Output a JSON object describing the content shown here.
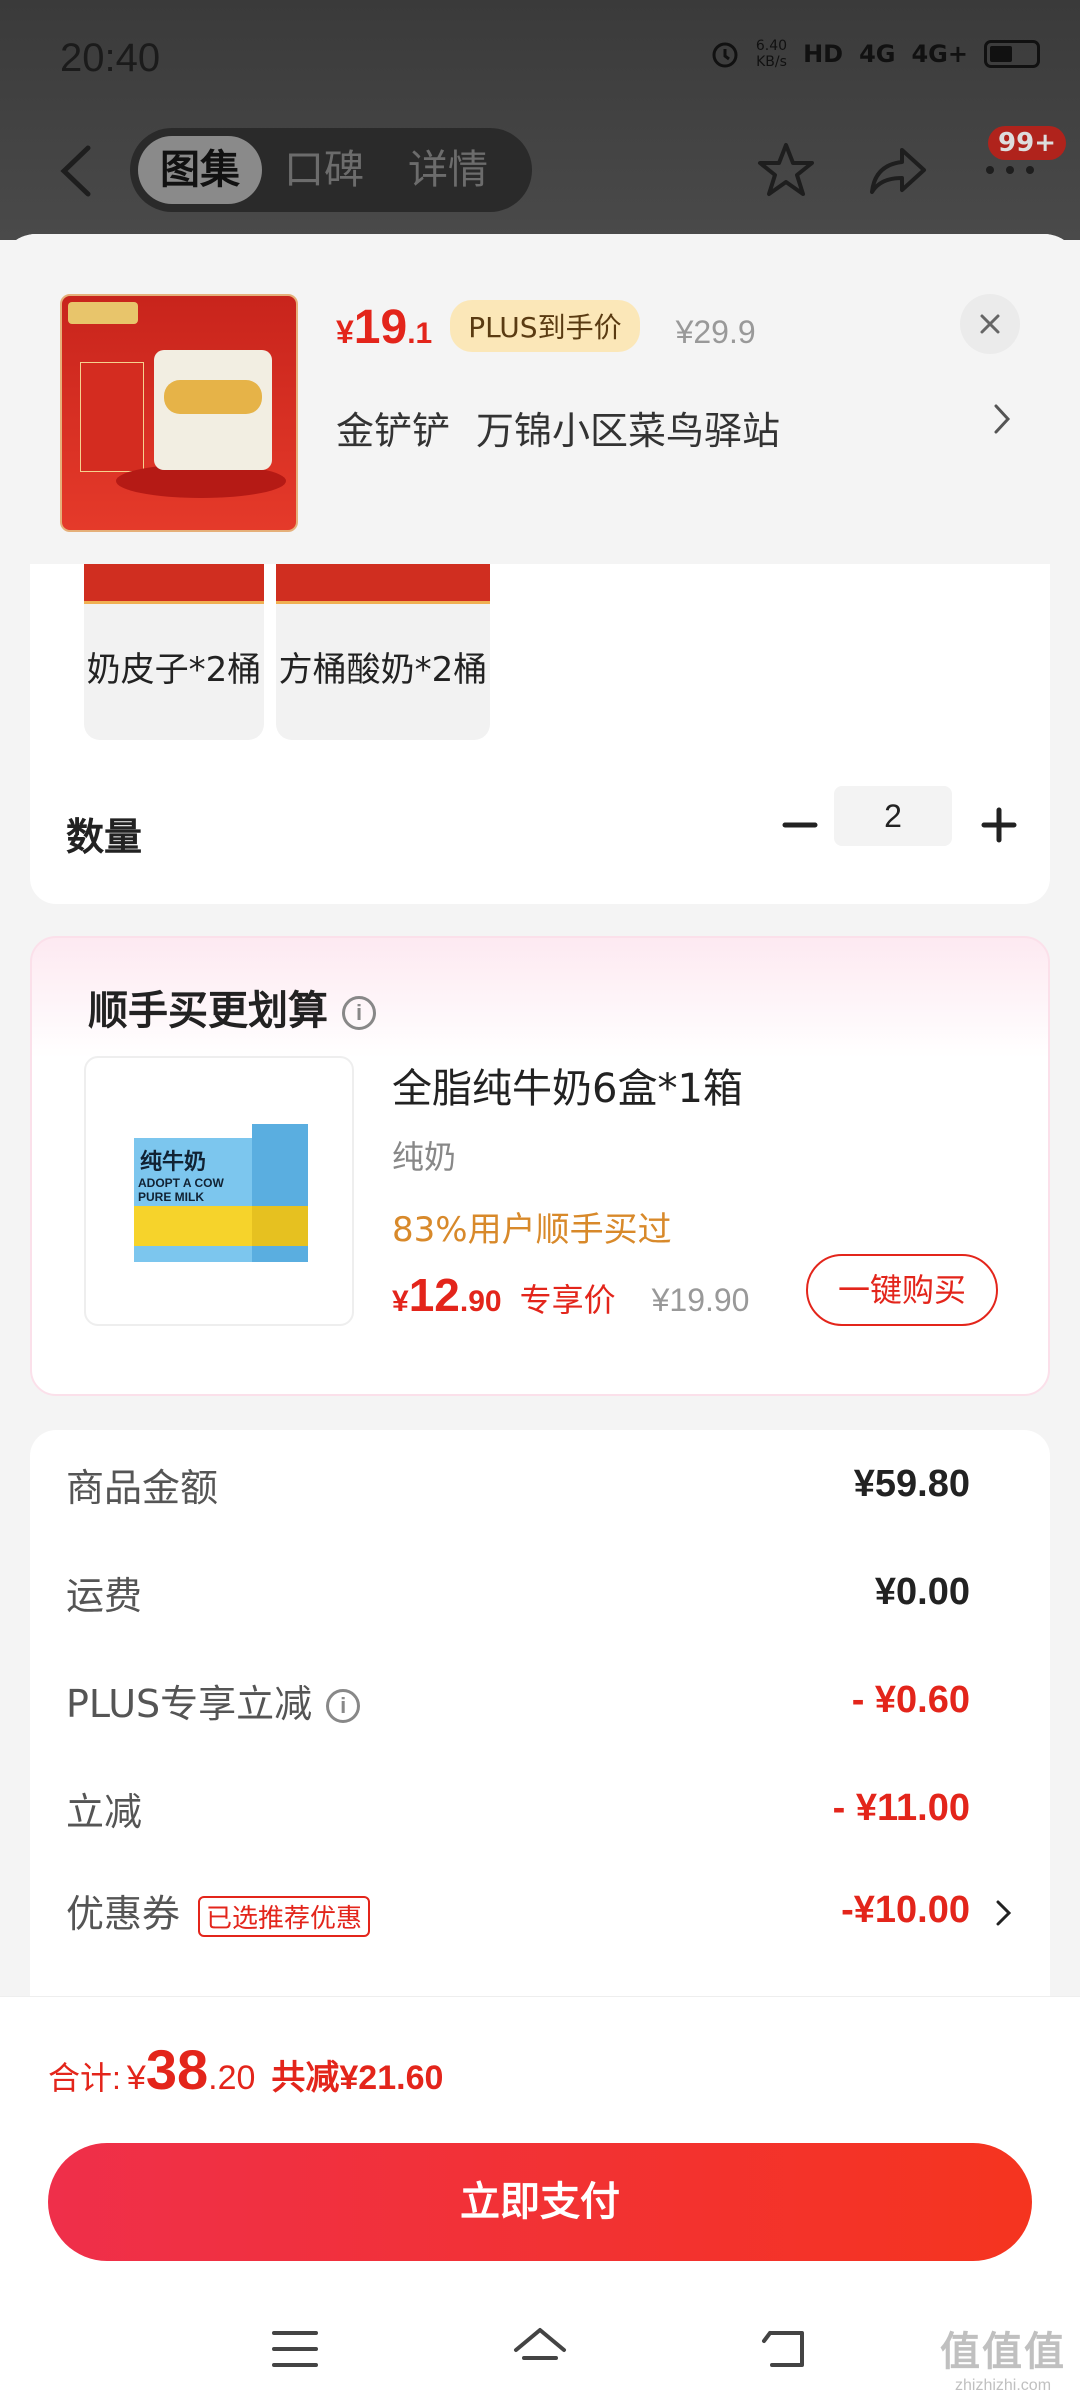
{
  "status_bar": {
    "time": "20:40",
    "net_speed_top": "6.40",
    "net_speed_bottom": "KB/s",
    "hd": "HD",
    "signal1": "4G",
    "signal2": "4G+"
  },
  "top_nav": {
    "tabs": [
      {
        "label": "图集",
        "active": true
      },
      {
        "label": "口碑",
        "active": false
      },
      {
        "label": "详情",
        "active": false
      }
    ],
    "badge": "99+"
  },
  "product": {
    "price_symbol": "¥",
    "price_int": "19",
    "price_dec": ".1",
    "plus_tag": "PLUS到手价",
    "orig_price": "¥29.9",
    "address_name": "金铲铲",
    "address_place": "万锦小区菜鸟驿站"
  },
  "specs": {
    "options": [
      "奶皮子*2桶",
      "方桶酸奶*2桶"
    ],
    "quantity_label": "数量",
    "quantity_value": "2"
  },
  "upsell": {
    "title": "顺手买更划算",
    "item_name": "全脂纯牛奶6盒*1箱",
    "item_sub": "纯奶",
    "purchase_rate": "83%用户顺手买过",
    "price_symbol": "¥",
    "price_int": "12",
    "price_dec": ".90",
    "price_tag": "专享价",
    "orig_price": "¥19.90",
    "buy_label": "一键购买",
    "box_title": "纯牛奶",
    "box_text": "ADOPT A COW PURE MILK"
  },
  "totals": {
    "rows": [
      {
        "label": "商品金额",
        "value": "¥59.80",
        "red": false
      },
      {
        "label": "运费",
        "value": "¥0.00",
        "red": false
      },
      {
        "label": "PLUS专享立减",
        "value": "- ¥0.60",
        "red": true
      },
      {
        "label": "立减",
        "value": "- ¥11.00",
        "red": true
      },
      {
        "label": "优惠券",
        "value": "-¥10.00",
        "red": true
      }
    ],
    "coupon_tag": "已选推荐优惠"
  },
  "footer": {
    "total_label": "合计:",
    "total_symbol": "¥",
    "total_int": "38",
    "total_dec": ".20",
    "save_text": "共减¥21.60",
    "pay_label": "立即支付"
  },
  "watermark": {
    "logo": "值值值",
    "url": "zhizhizhi.com"
  },
  "colors": {
    "accent": "#e3251b",
    "plus_bg": "#fbe7b8",
    "upsell_rate": "#d8892a"
  }
}
